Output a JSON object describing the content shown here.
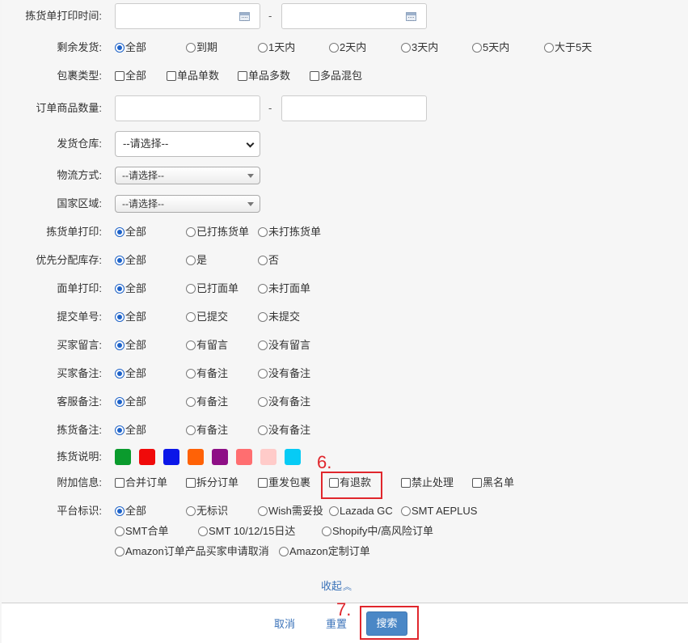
{
  "fields": {
    "pick_print_time": {
      "label": "拣货单打印时间:",
      "dash": "-"
    },
    "remaining_ship": {
      "label": "剩余发货:",
      "options": [
        "全部",
        "到期",
        "1天内",
        "2天内",
        "3天内",
        "5天内",
        "大于5天"
      ]
    },
    "package_type": {
      "label": "包裹类型:",
      "options": [
        "全部",
        "单品单数",
        "单品多数",
        "多品混包"
      ]
    },
    "order_qty": {
      "label": "订单商品数量:",
      "dash": "-"
    },
    "warehouse": {
      "label": "发货仓库:",
      "value": "--请选择--"
    },
    "logistics": {
      "label": "物流方式:",
      "value": "--请选择--"
    },
    "country": {
      "label": "国家区域:",
      "value": "--请选择--"
    },
    "pick_print": {
      "label": "拣货单打印:",
      "options": [
        "全部",
        "已打拣货单",
        "未打拣货单"
      ]
    },
    "priority_stock": {
      "label": "优先分配库存:",
      "options": [
        "全部",
        "是",
        "否"
      ]
    },
    "waybill_print": {
      "label": "面单打印:",
      "options": [
        "全部",
        "已打面单",
        "未打面单"
      ]
    },
    "submit_no": {
      "label": "提交单号:",
      "options": [
        "全部",
        "已提交",
        "未提交"
      ]
    },
    "buyer_msg": {
      "label": "买家留言:",
      "options": [
        "全部",
        "有留言",
        "没有留言"
      ]
    },
    "buyer_note": {
      "label": "买家备注:",
      "options": [
        "全部",
        "有备注",
        "没有备注"
      ]
    },
    "cs_note": {
      "label": "客服备注:",
      "options": [
        "全部",
        "有备注",
        "没有备注"
      ]
    },
    "pick_note": {
      "label": "拣货备注:",
      "options": [
        "全部",
        "有备注",
        "没有备注"
      ]
    },
    "pick_desc": {
      "label": "拣货说明:",
      "colors": [
        "#0a9b2d",
        "#f00a0a",
        "#0b16e8",
        "#ff6206",
        "#8e0f86",
        "#ff6e70",
        "#ffcbc9",
        "#06cbf5"
      ]
    },
    "extra_info": {
      "label": "附加信息:",
      "options": [
        "合并订单",
        "拆分订单",
        "重发包裹",
        "有退款",
        "禁止处理",
        "黑名单"
      ]
    },
    "platform": {
      "label": "平台标识:",
      "options": [
        "全部",
        "无标识",
        "Wish需妥投",
        "Lazada GC",
        "SMT AEPLUS",
        "SMT合单",
        "SMT 10/12/15日达",
        "Shopify中/高风险订单",
        "Amazon订单产品买家申请取消",
        "Amazon定制订单"
      ]
    }
  },
  "collapse_label": "收起",
  "footer": {
    "cancel": "取消",
    "reset": "重置",
    "search": "搜索"
  },
  "annotations": {
    "step6": "6.",
    "step7": "7."
  },
  "colors": {
    "accent": "#1d62c8",
    "link": "#3b73b9",
    "button": "#4a87c6",
    "annotation": "#e0262c"
  }
}
